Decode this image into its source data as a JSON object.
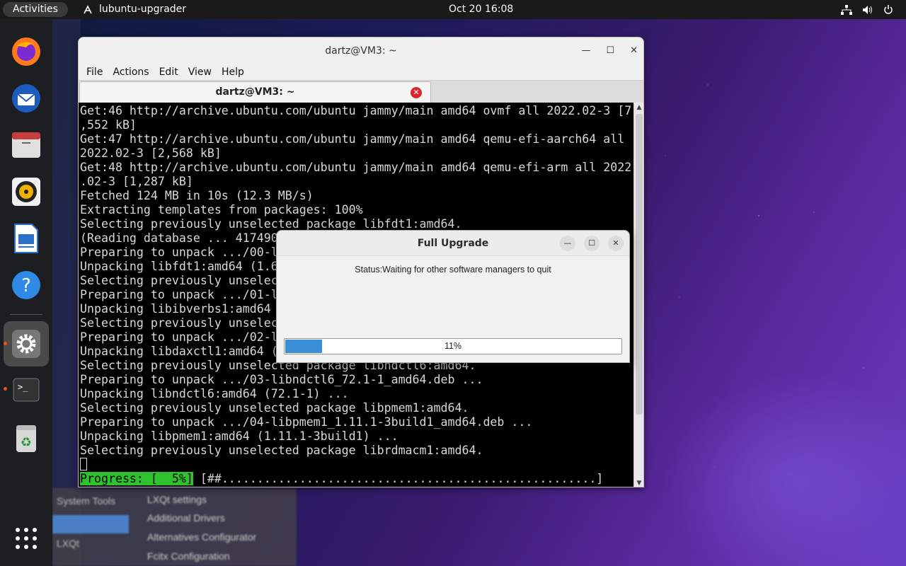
{
  "topbar": {
    "activities": "Activities",
    "app_name": "lubuntu-upgrader",
    "clock": "Oct 20  16:08"
  },
  "dock": {
    "items": [
      "firefox-icon",
      "thunderbird-icon",
      "files-icon",
      "rhythmbox-icon",
      "writer-icon",
      "help-icon",
      "settings-icon",
      "terminal-icon",
      "trash-icon",
      "show-apps-icon"
    ]
  },
  "background_menu": {
    "left_items": [
      "System Tools",
      "LXQt"
    ],
    "items": [
      "LXQt settings",
      "Additional Drivers",
      "Alternatives Configurator",
      "Fcitx Configuration"
    ]
  },
  "terminal": {
    "title": "dartz@VM3: ~",
    "menu": [
      "File",
      "Actions",
      "Edit",
      "View",
      "Help"
    ],
    "tab_title": "dartz@VM3: ~",
    "lines": [
      "Get:46 http://archive.ubuntu.com/ubuntu jammy/main amd64 ovmf all 2022.02-3 [7",
      ",552 kB]",
      "Get:47 http://archive.ubuntu.com/ubuntu jammy/main amd64 qemu-efi-aarch64 all",
      "2022.02-3 [2,568 kB]",
      "Get:48 http://archive.ubuntu.com/ubuntu jammy/main amd64 qemu-efi-arm all 2022",
      ".02-3 [1,287 kB]",
      "Fetched 124 MB in 10s (12.3 MB/s)",
      "Extracting templates from packages: 100%",
      "Selecting previously unselected package libfdt1:amd64.",
      "(Reading database ... 417490",
      "Preparing to unpack .../00-l",
      "Unpacking libfdt1:amd64 (1.6",
      "Selecting previously unselec",
      "Preparing to unpack .../01-l",
      "Unpacking libibverbs1:amd64",
      "Selecting previously unselec",
      "Preparing to unpack .../02-l",
      "Unpacking libdaxctl1:amd64 (",
      "Selecting previously unselected package libndctl6:amd64.",
      "Preparing to unpack .../03-libndctl6_72.1-1_amd64.deb ...",
      "Unpacking libndctl6:amd64 (72.1-1) ...",
      "Selecting previously unselected package libpmem1:amd64.",
      "Preparing to unpack .../04-libpmem1_1.11.1-3build1_amd64.deb ...",
      "Unpacking libpmem1:amd64 (1.11.1-3build1) ...",
      "Selecting previously unselected package librdmacm1:amd64."
    ],
    "progress_label": "Progress: [  5%]",
    "progress_bar": " [##.....................................................]",
    "progress_value": 0.05
  },
  "dialog": {
    "title": "Full Upgrade",
    "status": "Status:Waiting for other software managers to quit",
    "progress_text": "11%",
    "progress_value": 0.11,
    "accent": "#3a8ed8"
  }
}
